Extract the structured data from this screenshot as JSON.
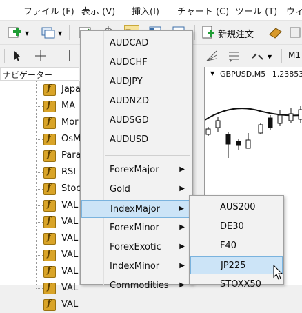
{
  "menubar": {
    "items": [
      "ファイル (F)",
      "表示 (V)",
      "挿入(I)",
      "チャート (C)",
      "ツール (T)",
      "ウィ"
    ]
  },
  "toolbar": {
    "new_order_label": "新規注文",
    "timeframe_label": "M1"
  },
  "navigator": {
    "title": "ナビゲーター",
    "items": [
      "Japa",
      "MA",
      "Mor",
      "OsM",
      "Para",
      "RSI",
      "Stoc",
      "VAL",
      "VAL",
      "VAL",
      "VAL",
      "VAL",
      "VAL",
      "VAL"
    ]
  },
  "chart": {
    "title": "GBPUSD,M5",
    "price": "1.23853"
  },
  "menu1": {
    "symbols": [
      "AUDCAD",
      "AUDCHF",
      "AUDJPY",
      "AUDNZD",
      "AUDSGD",
      "AUDUSD"
    ],
    "groups": [
      "ForexMajor",
      "Gold",
      "IndexMajor",
      "ForexMinor",
      "ForexExotic",
      "IndexMinor",
      "Commodities"
    ],
    "selected_group": "IndexMajor"
  },
  "menu2": {
    "items": [
      "AUS200",
      "DE30",
      "F40",
      "JP225",
      "STOXX50"
    ],
    "selected": "JP225"
  },
  "colors": {
    "selection_bg": "#cce4f7",
    "selection_border": "#7ab3de",
    "nav_icon": "#d9a428"
  }
}
